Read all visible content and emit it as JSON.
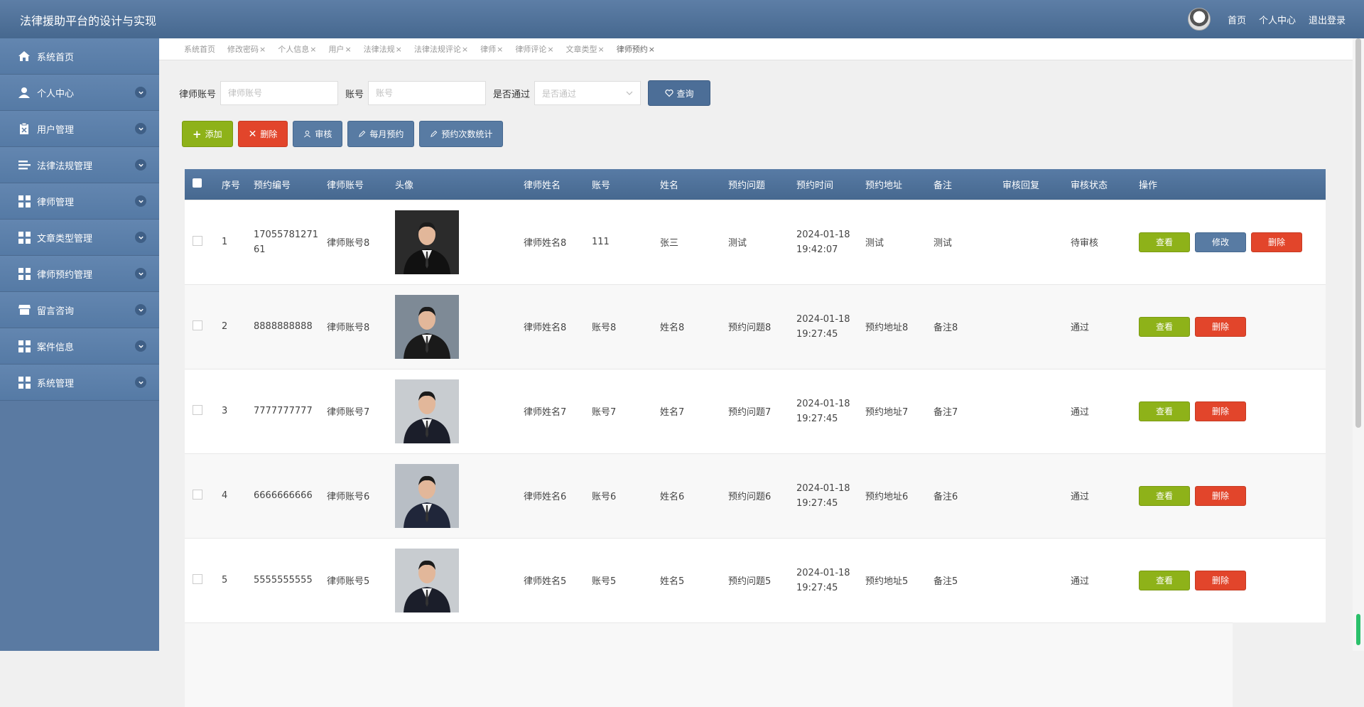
{
  "header": {
    "title": "法律援助平台的设计与实现",
    "links": [
      "首页",
      "个人中心",
      "退出登录"
    ]
  },
  "sidebar": {
    "items": [
      {
        "label": "系统首页",
        "icon": "home-icon",
        "expandable": false
      },
      {
        "label": "个人中心",
        "icon": "user-icon",
        "expandable": true
      },
      {
        "label": "用户管理",
        "icon": "clipboard-icon",
        "expandable": true
      },
      {
        "label": "法律法规管理",
        "icon": "list-icon",
        "expandable": true
      },
      {
        "label": "律师管理",
        "icon": "grid-icon",
        "expandable": true
      },
      {
        "label": "文章类型管理",
        "icon": "grid-icon",
        "expandable": true
      },
      {
        "label": "律师预约管理",
        "icon": "grid-icon",
        "expandable": true
      },
      {
        "label": "留言咨询",
        "icon": "store-icon",
        "expandable": true
      },
      {
        "label": "案件信息",
        "icon": "grid-icon",
        "expandable": true
      },
      {
        "label": "系统管理",
        "icon": "grid-icon",
        "expandable": true
      }
    ]
  },
  "tabs": [
    {
      "label": "系统首页",
      "closable": false
    },
    {
      "label": "修改密码",
      "closable": true
    },
    {
      "label": "个人信息",
      "closable": true
    },
    {
      "label": "用户",
      "closable": true
    },
    {
      "label": "法律法规",
      "closable": true
    },
    {
      "label": "法律法规评论",
      "closable": true
    },
    {
      "label": "律师",
      "closable": true
    },
    {
      "label": "律师评论",
      "closable": true
    },
    {
      "label": "文章类型",
      "closable": true
    },
    {
      "label": "律师预约",
      "closable": true,
      "active": true
    }
  ],
  "tab_close": "×",
  "search": {
    "lawyer_account_label": "律师账号",
    "lawyer_account_placeholder": "律师账号",
    "account_label": "账号",
    "account_placeholder": "账号",
    "passed_label": "是否通过",
    "passed_placeholder": "是否通过",
    "query_label": "查询"
  },
  "toolbar": {
    "add": "添加",
    "delete": "删除",
    "review": "审核",
    "monthly": "每月预约",
    "stats": "预约次数统计"
  },
  "table": {
    "columns": [
      "序号",
      "预约编号",
      "律师账号",
      "头像",
      "律师姓名",
      "账号",
      "姓名",
      "预约问题",
      "预约时间",
      "预约地址",
      "备注",
      "审核回复",
      "审核状态",
      "操作"
    ],
    "view_label": "查看",
    "edit_label": "修改",
    "delete_label": "删除",
    "rows": [
      {
        "no": "1",
        "booking_id": "1705578127161",
        "lawyer_account": "律师账号8",
        "lawyer_name": "律师姓名8",
        "account": "111",
        "name": "张三",
        "question": "测试",
        "date": "2024-01-18",
        "time": "19:42:07",
        "address": "测试",
        "note": "测试",
        "reply": "",
        "status": "待审核",
        "editable": true
      },
      {
        "no": "2",
        "booking_id": "8888888888",
        "lawyer_account": "律师账号8",
        "lawyer_name": "律师姓名8",
        "account": "账号8",
        "name": "姓名8",
        "question": "预约问题8",
        "date": "2024-01-18",
        "time": "19:27:45",
        "address": "预约地址8",
        "note": "备注8",
        "reply": "",
        "status": "通过",
        "editable": false
      },
      {
        "no": "3",
        "booking_id": "7777777777",
        "lawyer_account": "律师账号7",
        "lawyer_name": "律师姓名7",
        "account": "账号7",
        "name": "姓名7",
        "question": "预约问题7",
        "date": "2024-01-18",
        "time": "19:27:45",
        "address": "预约地址7",
        "note": "备注7",
        "reply": "",
        "status": "通过",
        "editable": false
      },
      {
        "no": "4",
        "booking_id": "6666666666",
        "lawyer_account": "律师账号6",
        "lawyer_name": "律师姓名6",
        "account": "账号6",
        "name": "姓名6",
        "question": "预约问题6",
        "date": "2024-01-18",
        "time": "19:27:45",
        "address": "预约地址6",
        "note": "备注6",
        "reply": "",
        "status": "通过",
        "editable": false
      },
      {
        "no": "5",
        "booking_id": "5555555555",
        "lawyer_account": "律师账号5",
        "lawyer_name": "律师姓名5",
        "account": "账号5",
        "name": "姓名5",
        "question": "预约问题5",
        "date": "2024-01-18",
        "time": "19:27:45",
        "address": "预约地址5",
        "note": "备注5",
        "reply": "",
        "status": "通过",
        "editable": false
      }
    ]
  },
  "colors": {
    "header": "#4f7199",
    "sidebar": "#5a7aa2",
    "green": "#8eb219",
    "red": "#e2452b",
    "blue": "#587ba3"
  }
}
